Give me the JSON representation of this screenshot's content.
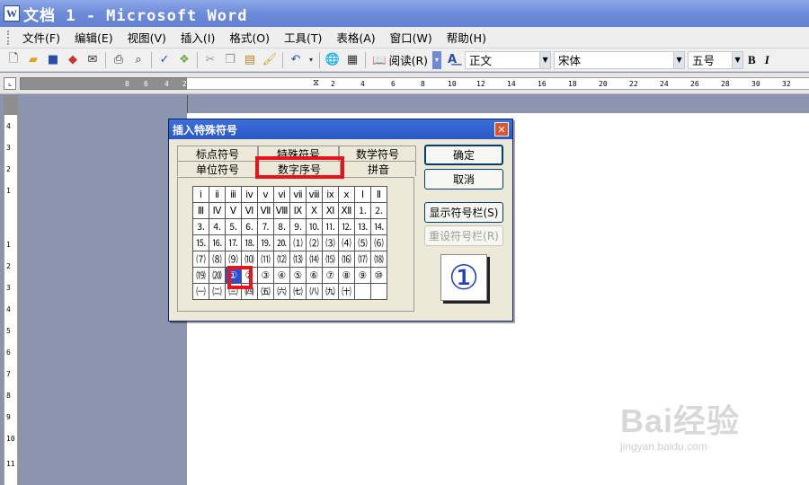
{
  "window": {
    "title": "文档 1 - Microsoft Word"
  },
  "menu": [
    "文件(F)",
    "编辑(E)",
    "视图(V)",
    "插入(I)",
    "格式(O)",
    "工具(T)",
    "表格(A)",
    "窗口(W)",
    "帮助(H)"
  ],
  "toolbar": {
    "read_label": "阅读(R)",
    "style": "正文",
    "font": "宋体",
    "size": "五号",
    "bold": "B",
    "italic": "I"
  },
  "ruler": {
    "gray_labels": [
      "8",
      "6",
      "4",
      "2"
    ],
    "labels": [
      "2",
      "4",
      "6",
      "8",
      "10",
      "12",
      "14",
      "16",
      "18",
      "20",
      "22",
      "24",
      "26",
      "28",
      "30",
      "32"
    ],
    "vertical_labels": [
      "4",
      "3",
      "2",
      "1",
      "1",
      "2",
      "3",
      "4",
      "5",
      "6",
      "7",
      "8",
      "9",
      "10",
      "11"
    ]
  },
  "dialog": {
    "title": "插入特殊符号",
    "tabs": {
      "row1": [
        "标点符号",
        "特殊符号",
        "数学符号"
      ],
      "row2": [
        "单位符号",
        "数字序号",
        "拼音"
      ]
    },
    "active_tab": "数字序号",
    "grid": [
      [
        "ⅰ",
        "ⅱ",
        "ⅲ",
        "ⅳ",
        "ⅴ",
        "ⅵ",
        "ⅶ",
        "ⅷ",
        "ⅸ",
        "ⅹ",
        "Ⅰ",
        "Ⅱ"
      ],
      [
        "Ⅲ",
        "Ⅳ",
        "Ⅴ",
        "Ⅵ",
        "Ⅶ",
        "Ⅷ",
        "Ⅸ",
        "Ⅹ",
        "Ⅺ",
        "Ⅻ",
        "⒈",
        "⒉"
      ],
      [
        "⒊",
        "⒋",
        "⒌",
        "⒍",
        "⒎",
        "⒏",
        "⒐",
        "⒑",
        "⒒",
        "⒓",
        "⒔",
        "⒕"
      ],
      [
        "⒖",
        "⒗",
        "⒘",
        "⒙",
        "⒚",
        "⒛",
        "⑴",
        "⑵",
        "⑶",
        "⑷",
        "⑸",
        "⑹"
      ],
      [
        "⑺",
        "⑻",
        "⑼",
        "⑽",
        "⑾",
        "⑿",
        "⒀",
        "⒁",
        "⒂",
        "⒃",
        "⒄",
        "⒅"
      ],
      [
        "⒆",
        "⒇",
        "①",
        "②",
        "③",
        "④",
        "⑤",
        "⑥",
        "⑦",
        "⑧",
        "⑨",
        "⑩"
      ],
      [
        "㈠",
        "㈡",
        "㈢",
        "㈣",
        "㈤",
        "㈥",
        "㈦",
        "㈧",
        "㈨",
        "㈩",
        "",
        ""
      ]
    ],
    "selected_symbol": "①",
    "buttons": {
      "ok": "确定",
      "cancel": "取消",
      "show_bar": "显示符号栏(S)",
      "reset_bar": "重设符号栏(R)"
    },
    "preview": "①"
  },
  "watermark": {
    "main": "Bai经验",
    "sub": "jingyan.baidu.com"
  },
  "colors": {
    "title_bar": "#6d8bd9",
    "dialog_title": "#2a58c8",
    "highlight": "#e8141c",
    "selected": "#2a4fd0"
  }
}
